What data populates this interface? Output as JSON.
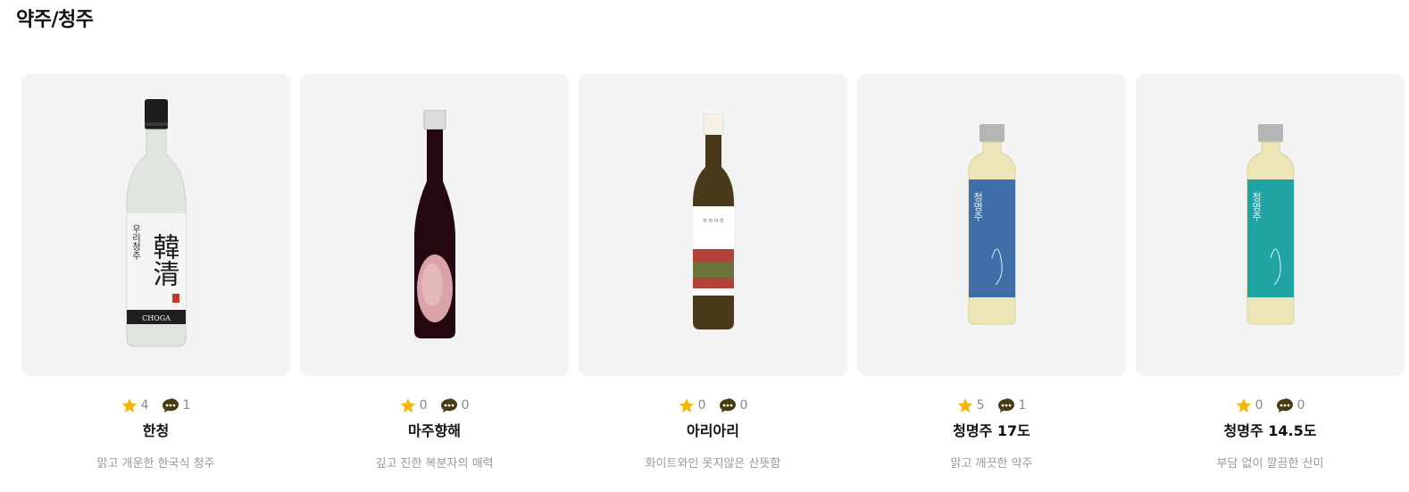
{
  "section": {
    "title": "약주/청주"
  },
  "products": [
    {
      "name": "한청",
      "rating": "4",
      "comments": "1",
      "description": "맑고 개운한 한국식 청주",
      "label_main": "韓清",
      "label_side": "우리청주",
      "label_brand": "CHOGA"
    },
    {
      "name": "마주향해",
      "rating": "0",
      "comments": "0",
      "description": "깊고 진한 복분자의 매력"
    },
    {
      "name": "아리아리",
      "rating": "0",
      "comments": "0",
      "description": "화이트와인 못지않은 산뜻함",
      "label_text": "아 리 아 리"
    },
    {
      "name": "청명주 17도",
      "rating": "5",
      "comments": "1",
      "description": "맑고 깨끗한 약주",
      "label_text": "청명주"
    },
    {
      "name": "청명주 14.5도",
      "rating": "0",
      "comments": "0",
      "description": "부담 없이 깔끔한 산미",
      "label_text": "청명주"
    }
  ],
  "colors": {
    "star": "#f5b400",
    "comment_icon": "#4a3a12",
    "card_bg": "#f3f3f3"
  },
  "icons": {
    "rating": "star-icon",
    "comments": "speech-bubble-icon"
  }
}
